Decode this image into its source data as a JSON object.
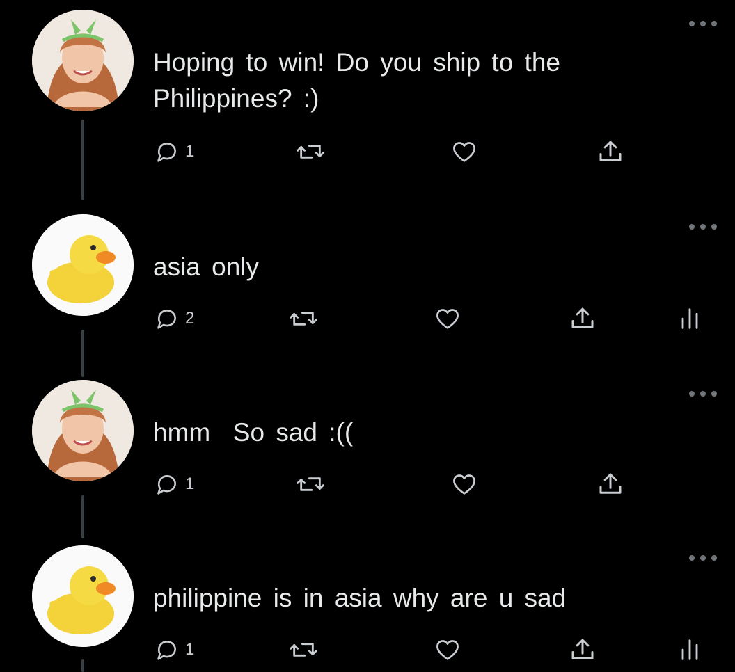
{
  "thread": [
    {
      "avatar": "girl-with-headband-avatar",
      "text": "Hoping to win! Do you ship to the\nPhilippines? :)",
      "reply_count": "1",
      "has_analytics": false
    },
    {
      "avatar": "rubber-duck-avatar",
      "text": "asia only",
      "reply_count": "2",
      "has_analytics": true
    },
    {
      "avatar": "girl-with-headband-avatar",
      "text": "hmm  So sad :((",
      "reply_count": "1",
      "has_analytics": false
    },
    {
      "avatar": "rubber-duck-avatar",
      "text": "philippine is in asia why are u sad",
      "reply_count": "1",
      "has_analytics": true
    }
  ],
  "icons": {
    "reply": "reply-icon",
    "retweet": "retweet-icon",
    "like": "heart-icon",
    "share": "share-icon",
    "analytics": "analytics-icon",
    "more": "more-icon"
  },
  "colors": {
    "background": "#000000",
    "text": "#e7e9ea",
    "icon": "#c9cdd1",
    "thread_line": "#3a3f44"
  }
}
